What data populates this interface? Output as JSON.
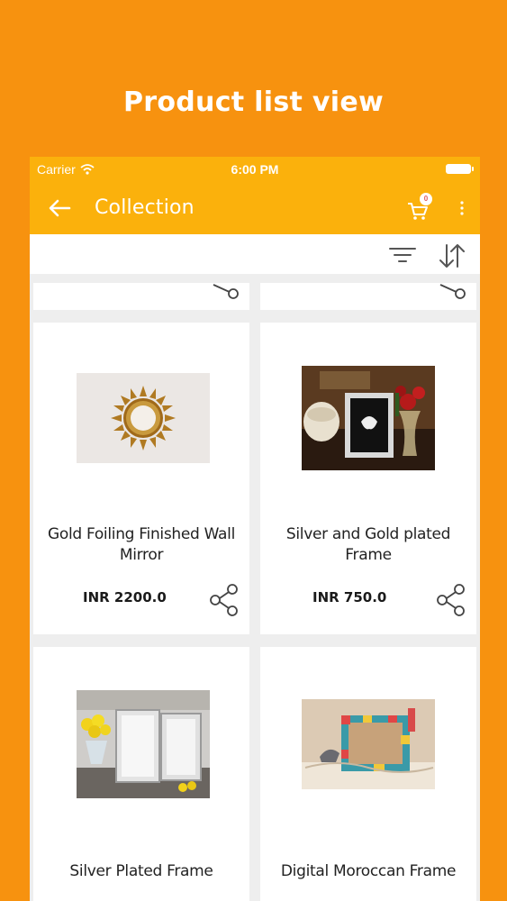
{
  "headline": "Product list view",
  "status_bar": {
    "carrier": "Carrier",
    "time": "6:00 PM"
  },
  "app_bar": {
    "title": "Collection",
    "cart_count": "0"
  },
  "products": [
    {
      "name": "Gold Foiling Finished Wall Mirror",
      "price": "INR 2200.0"
    },
    {
      "name": "Silver and Gold plated Frame",
      "price": "INR 750.0"
    },
    {
      "name": "Silver Plated Frame",
      "price": ""
    },
    {
      "name": "Digital Moroccan Frame",
      "price": ""
    }
  ],
  "colors": {
    "background": "#F7920F",
    "toolbar": "#FBB10C",
    "card": "#FFFFFF"
  },
  "icons": [
    "back-arrow-icon",
    "cart-icon",
    "more-vert-icon",
    "filter-icon",
    "sort-icon",
    "share-icon",
    "wifi-icon",
    "battery-icon"
  ]
}
